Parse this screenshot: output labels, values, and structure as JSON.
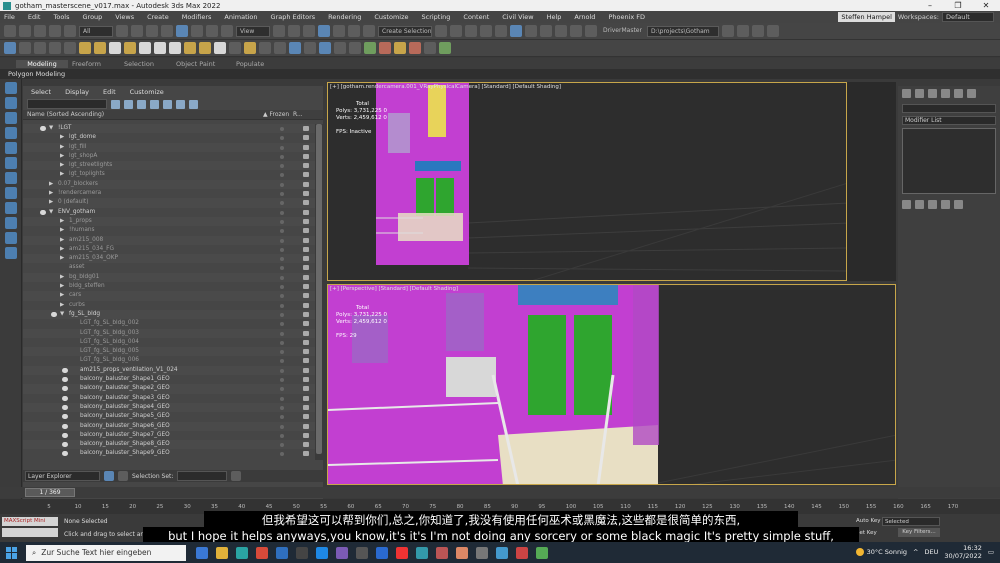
{
  "window": {
    "title": "gotham_masterscene_v017.max - Autodesk 3ds Max 2022"
  },
  "menu": [
    "File",
    "Edit",
    "Tools",
    "Group",
    "Views",
    "Create",
    "Modifiers",
    "Animation",
    "Graph Editors",
    "Rendering",
    "Customize",
    "Scripting",
    "Content",
    "Civil View",
    "Help",
    "Arnold",
    "Phoenix FD"
  ],
  "account": "Steffen Hampel",
  "workspaces_label": "Workspaces:",
  "workspace": "Default",
  "toolbar": {
    "filter": "All",
    "view": "View",
    "selection_set": "Create Selection Se",
    "driver": "DriverMaster",
    "project_path": "D:\\projects\\Gotham"
  },
  "ribbon": {
    "tabs": [
      "Modeling",
      "Freeform",
      "Selection",
      "Object Paint",
      "Populate"
    ],
    "sub": "Polygon Modeling"
  },
  "explorer": {
    "menu": [
      "Select",
      "Display",
      "Edit",
      "Customize"
    ],
    "col_name": "Name (Sorted Ascending)",
    "col_frozen": "▲ Frozen",
    "col_render": "R...",
    "rows": [
      {
        "label": "!LGT",
        "indent": 0,
        "arrow": "▼",
        "eye": true,
        "dim": false
      },
      {
        "label": "lgt_dome",
        "indent": 1,
        "arrow": "▶",
        "eye": false,
        "dim": false
      },
      {
        "label": "lgt_fill",
        "indent": 1,
        "arrow": "▶",
        "eye": false,
        "dim": true
      },
      {
        "label": "lgt_shopA",
        "indent": 1,
        "arrow": "▶",
        "eye": false,
        "dim": true
      },
      {
        "label": "lgt_streetlights",
        "indent": 1,
        "arrow": "▶",
        "eye": false,
        "dim": true
      },
      {
        "label": "lgt_toplights",
        "indent": 1,
        "arrow": "▶",
        "eye": false,
        "dim": true
      },
      {
        "label": "0.07_blockers",
        "indent": 0,
        "arrow": "▶",
        "eye": false,
        "dim": true
      },
      {
        "label": "!rendercamera",
        "indent": 0,
        "arrow": "▶",
        "eye": false,
        "dim": true
      },
      {
        "label": "0 (default)",
        "indent": 0,
        "arrow": "▶",
        "eye": false,
        "dim": true
      },
      {
        "label": "ENV_gotham",
        "indent": 0,
        "arrow": "▼",
        "eye": true,
        "dim": false
      },
      {
        "label": "1_props",
        "indent": 1,
        "arrow": "▶",
        "eye": false,
        "dim": true
      },
      {
        "label": "!humans",
        "indent": 1,
        "arrow": "▶",
        "eye": false,
        "dim": true
      },
      {
        "label": "am215_008",
        "indent": 1,
        "arrow": "▶",
        "eye": false,
        "dim": true
      },
      {
        "label": "am215_034_FG",
        "indent": 1,
        "arrow": "▶",
        "eye": false,
        "dim": true
      },
      {
        "label": "am215_034_OKP",
        "indent": 1,
        "arrow": "▶",
        "eye": false,
        "dim": true
      },
      {
        "label": "asset",
        "indent": 1,
        "arrow": "",
        "eye": false,
        "dim": true
      },
      {
        "label": "bg_bldg01",
        "indent": 1,
        "arrow": "▶",
        "eye": false,
        "dim": true
      },
      {
        "label": "bldg_steffen",
        "indent": 1,
        "arrow": "▶",
        "eye": false,
        "dim": true
      },
      {
        "label": "cars",
        "indent": 1,
        "arrow": "▶",
        "eye": false,
        "dim": true
      },
      {
        "label": "curbs",
        "indent": 1,
        "arrow": "▶",
        "eye": false,
        "dim": true
      },
      {
        "label": "fg_SL_bldg",
        "indent": 1,
        "arrow": "▼",
        "eye": true,
        "dim": false
      },
      {
        "label": "LGT_fg_SL_bldg_002",
        "indent": 2,
        "arrow": "",
        "eye": false,
        "dim": true
      },
      {
        "label": "LGT_fg_SL_bldg_003",
        "indent": 2,
        "arrow": "",
        "eye": false,
        "dim": true
      },
      {
        "label": "LGT_fg_SL_bldg_004",
        "indent": 2,
        "arrow": "",
        "eye": false,
        "dim": true
      },
      {
        "label": "LGT_fg_SL_bldg_005",
        "indent": 2,
        "arrow": "",
        "eye": false,
        "dim": true
      },
      {
        "label": "LGT_fg_SL_bldg_006",
        "indent": 2,
        "arrow": "",
        "eye": false,
        "dim": true
      },
      {
        "label": "am215_props_ventilation_V1_024",
        "indent": 2,
        "arrow": "",
        "eye": true,
        "dim": false
      },
      {
        "label": "balcony_baluster_Shape1_GEO",
        "indent": 2,
        "arrow": "",
        "eye": true,
        "dim": false
      },
      {
        "label": "balcony_baluster_Shape2_GEO",
        "indent": 2,
        "arrow": "",
        "eye": true,
        "dim": false
      },
      {
        "label": "balcony_baluster_Shape3_GEO",
        "indent": 2,
        "arrow": "",
        "eye": true,
        "dim": false
      },
      {
        "label": "balcony_baluster_Shape4_GEO",
        "indent": 2,
        "arrow": "",
        "eye": true,
        "dim": false
      },
      {
        "label": "balcony_baluster_Shape5_GEO",
        "indent": 2,
        "arrow": "",
        "eye": true,
        "dim": false
      },
      {
        "label": "balcony_baluster_Shape6_GEO",
        "indent": 2,
        "arrow": "",
        "eye": true,
        "dim": false
      },
      {
        "label": "balcony_baluster_Shape7_GEO",
        "indent": 2,
        "arrow": "",
        "eye": true,
        "dim": false
      },
      {
        "label": "balcony_baluster_Shape8_GEO",
        "indent": 2,
        "arrow": "",
        "eye": true,
        "dim": false
      },
      {
        "label": "balcony_baluster_Shape9_GEO",
        "indent": 2,
        "arrow": "",
        "eye": true,
        "dim": false
      }
    ],
    "layer_explorer": "Layer Explorer",
    "selection_set_label": "Selection Set:"
  },
  "viewport_top": {
    "header": "[+] [gotham.rendercamera.001_VRayPhysicalCamera] [Standard] [Default Shading]",
    "total": "Total",
    "polys_label": "Polys:",
    "polys": "3,731,225",
    "polys_sel": "0",
    "verts_label": "Verts:",
    "verts": "2,459,612",
    "verts_sel": "0",
    "fps_label": "FPS:",
    "fps": "Inactive"
  },
  "viewport_bottom": {
    "header": "[+] [Perspective] [Standard] [Default Shading]",
    "total": "Total",
    "polys_label": "Polys:",
    "polys": "3,731,225",
    "polys_sel": "0",
    "verts_label": "Verts:",
    "verts": "2,459,612",
    "verts_sel": "0",
    "fps_label": "FPS:",
    "fps": "29"
  },
  "command_panel": {
    "modifier_list": "Modifier List"
  },
  "timeline": {
    "frame": "1 / 369"
  },
  "ticks": [
    "5",
    "10",
    "15",
    "20",
    "25",
    "30",
    "35",
    "40",
    "45",
    "50",
    "55",
    "60",
    "65",
    "70",
    "75",
    "80",
    "85",
    "90",
    "95",
    "100",
    "105",
    "110",
    "115",
    "120",
    "125",
    "130",
    "135",
    "140",
    "145",
    "150",
    "155",
    "160",
    "165",
    "170"
  ],
  "status": {
    "maxscript": "MAXScript Mini",
    "none_selected": "None Selected",
    "prompt": "Click and drag to select and mo",
    "auto_key": "Auto Key",
    "set_key": "Set Key",
    "selected": "Selected",
    "key_filters": "Key Filters..."
  },
  "subtitles": {
    "zh": "但我希望这可以帮到你们,总之,你知道了,我没有使用任何巫术或黑魔法,这些都是很简单的东西,",
    "en": "but I hope it helps anyways,you know,it's it's I'm not doing any sorcery or some black magic It's pretty simple stuff,"
  },
  "taskbar": {
    "search": "Zur Suche Text hier eingeben",
    "weather": "30°C  Sonnig",
    "lang": "DEU",
    "time": "16:32",
    "date": "30/07/2022"
  },
  "colors": {
    "magenta": "#c23fd1",
    "green": "#2fa52f",
    "blue": "#3d7fc0",
    "cream": "#e8dfc4",
    "yellow": "#e8d35a",
    "viewport_frame": "#c7a64a"
  }
}
